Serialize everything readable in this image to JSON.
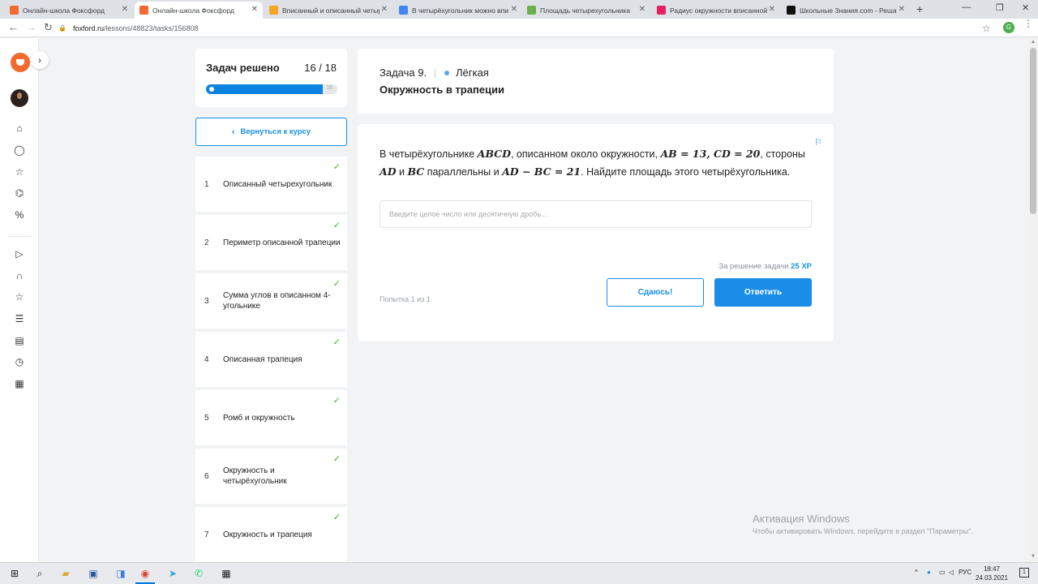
{
  "browser": {
    "tabs": [
      {
        "title": "Онлайн-школа Фоксфорд",
        "favicon_color": "#f26a2e",
        "active": false
      },
      {
        "title": "Онлайн-школа Фоксфорд",
        "favicon_color": "#f26a2e",
        "active": true
      },
      {
        "title": "Вписанный и описанный четыр",
        "favicon_color": "#f5a623",
        "active": false
      },
      {
        "title": "В четырёхугольник можно впи",
        "favicon_color": "#4285f4",
        "active": false
      },
      {
        "title": "Площадь четырехугольника",
        "favicon_color": "#6ab04c",
        "active": false
      },
      {
        "title": "Радиус окружности вписанной",
        "favicon_color": "#e91e63",
        "active": false
      },
      {
        "title": "Школьные Знания.com - Решаю",
        "favicon_color": "#111111",
        "active": false
      }
    ],
    "url_host": "foxford.ru",
    "url_path": "/lessons/48823/tasks/156808",
    "profile_letter": "G"
  },
  "progress": {
    "label": "Задач решено",
    "count": "16 / 18",
    "solved": 16,
    "total": 18,
    "bar_end": "16"
  },
  "back_button": "Вернуться к курсу",
  "task_list": [
    {
      "num": "1",
      "name": "Описанный четырехугольник",
      "done": true
    },
    {
      "num": "2",
      "name": "Периметр описанной трапеции",
      "done": true
    },
    {
      "num": "3",
      "name": "Сумма углов в описанном 4-угольнике",
      "done": true
    },
    {
      "num": "4",
      "name": "Описанная трапеция",
      "done": true
    },
    {
      "num": "5",
      "name": "Ромб и окружность",
      "done": true
    },
    {
      "num": "6",
      "name": "Окружность и четырёхугольник",
      "done": true
    },
    {
      "num": "7",
      "name": "Окружность и трапеция",
      "done": true
    }
  ],
  "task": {
    "number": "Задача 9.",
    "difficulty": "Лёгкая",
    "title": "Окружность в трапеции",
    "statement": {
      "t1": "В четырёхугольнике ",
      "m1": "ABCD",
      "t2": ", описанном около окружности, ",
      "m2": "AB = 13, CD = 20",
      "t3": ", стороны ",
      "m3": "AD",
      "t4": " и ",
      "m4": "BC",
      "t5": " параллельны и ",
      "m5": "AD − BC = 21",
      "t6": ". Найдите площадь этого четырёхугольника."
    },
    "input_placeholder": "Введите целое число или десятичную дробь...",
    "input_value": "",
    "reward_prefix": "За решение задачи",
    "reward_xp": "25 XP",
    "attempts": "Попытка 1 из 1",
    "giveup_label": "Сдаюсь!",
    "submit_label": "Ответить"
  },
  "watermark": {
    "line1": "Активация Windows",
    "line2": "Чтобы активировать Windows, перейдите в раздел \"Параметры\"."
  },
  "taskbar": {
    "lang": "РУС",
    "time": "18:47",
    "date": "24.03.2021",
    "notifications": "1"
  }
}
